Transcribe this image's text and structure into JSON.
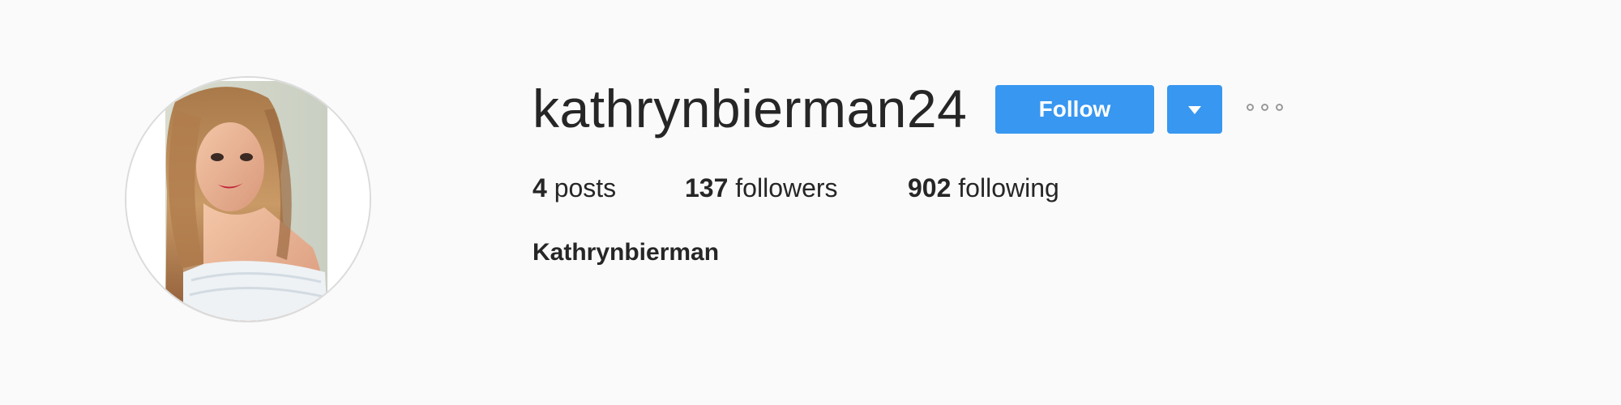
{
  "profile": {
    "username": "kathrynbierman24",
    "full_name": "Kathrynbierman",
    "avatar_icon": "profile-photo"
  },
  "actions": {
    "follow_label": "Follow",
    "dropdown_icon": "caret-down-icon",
    "options_icon": "more-options-icon"
  },
  "stats": {
    "posts": {
      "count": "4",
      "label": "posts"
    },
    "followers": {
      "count": "137",
      "label": "followers"
    },
    "following": {
      "count": "902",
      "label": "following"
    }
  },
  "colors": {
    "background": "#fafafa",
    "accent": "#3897f0",
    "text": "#262626",
    "muted": "#999999"
  }
}
